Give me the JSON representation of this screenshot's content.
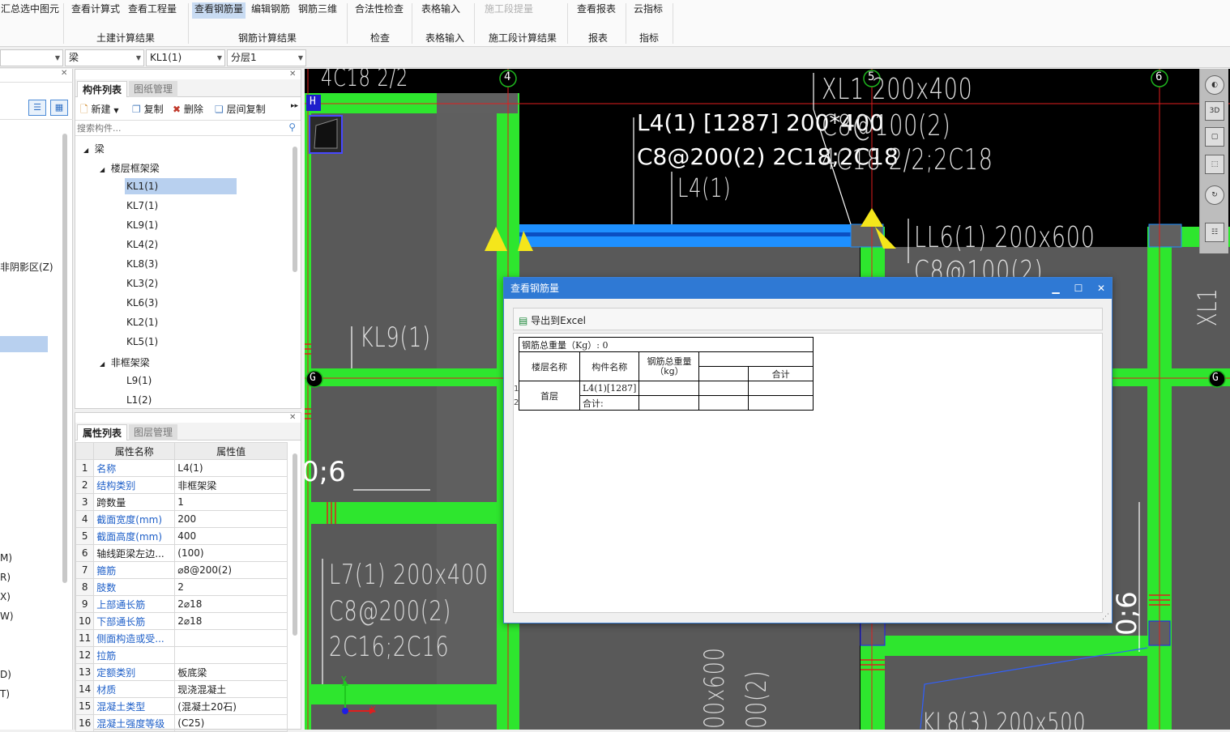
{
  "ribbon": {
    "buttons": [
      {
        "label": "汇总选中图元",
        "state": "normal"
      },
      {
        "label": "查看计算式",
        "state": "normal"
      },
      {
        "label": "查看工程量",
        "state": "normal"
      },
      {
        "label": "查看钢筋量",
        "state": "selected"
      },
      {
        "label": "编辑钢筋",
        "state": "normal"
      },
      {
        "label": "钢筋三维",
        "state": "normal"
      },
      {
        "label": "合法性检查",
        "state": "normal"
      },
      {
        "label": "表格输入",
        "state": "normal"
      },
      {
        "label": "施工段提量",
        "state": "disabled"
      },
      {
        "label": "查看报表",
        "state": "normal"
      },
      {
        "label": "云指标",
        "state": "normal"
      }
    ],
    "groups": [
      "土建计算结果",
      "钢筋计算结果",
      "检查",
      "表格输入",
      "施工段计算结果",
      "报表",
      "指标"
    ]
  },
  "selector_bar": {
    "combo1": "",
    "combo2": "梁",
    "combo3": "KL1(1)",
    "combo4": "分层1"
  },
  "left_panel": {
    "items": [
      "非阴影区(Z)",
      "M)",
      "R)",
      "X)",
      "W)",
      "D)",
      "T)"
    ]
  },
  "component_panel": {
    "tabs": [
      "构件列表",
      "图纸管理"
    ],
    "toolbar": {
      "new": "新建",
      "copy": "复制",
      "delete": "删除",
      "floor_copy": "层间复制"
    },
    "search_placeholder": "搜索构件...",
    "tree": {
      "root": "梁",
      "group1": "楼层框架梁",
      "group1_items": [
        "KL1(1)",
        "KL7(1)",
        "KL9(1)",
        "KL4(2)",
        "KL8(3)",
        "KL3(2)",
        "KL6(3)",
        "KL2(1)",
        "KL5(1)"
      ],
      "group2": "非框架梁",
      "group2_items": [
        "L9(1)",
        "L1(2)"
      ]
    }
  },
  "property_panel": {
    "tabs": [
      "属性列表",
      "图层管理"
    ],
    "headers": [
      "属性名称",
      "属性值"
    ],
    "rows": [
      {
        "n": "1",
        "k": "名称",
        "v": "L4(1)",
        "blue": true
      },
      {
        "n": "2",
        "k": "结构类别",
        "v": "非框架梁",
        "blue": true
      },
      {
        "n": "3",
        "k": "跨数量",
        "v": "1",
        "blue": false
      },
      {
        "n": "4",
        "k": "截面宽度(mm)",
        "v": "200",
        "blue": true
      },
      {
        "n": "5",
        "k": "截面高度(mm)",
        "v": "400",
        "blue": true
      },
      {
        "n": "6",
        "k": "轴线距梁左边...",
        "v": "(100)",
        "blue": false
      },
      {
        "n": "7",
        "k": "箍筋",
        "v": "⌀8@200(2)",
        "blue": true
      },
      {
        "n": "8",
        "k": "肢数",
        "v": "2",
        "blue": true
      },
      {
        "n": "9",
        "k": "上部通长筋",
        "v": "2⌀18",
        "blue": true
      },
      {
        "n": "10",
        "k": "下部通长筋",
        "v": "2⌀18",
        "blue": true
      },
      {
        "n": "11",
        "k": "侧面构造或受...",
        "v": "",
        "blue": true
      },
      {
        "n": "12",
        "k": "拉筋",
        "v": "",
        "blue": true
      },
      {
        "n": "13",
        "k": "定额类别",
        "v": "板底梁",
        "blue": true
      },
      {
        "n": "14",
        "k": "材质",
        "v": "现浇混凝土",
        "blue": true
      },
      {
        "n": "15",
        "k": "混凝土类型",
        "v": "(混凝土20石)",
        "blue": true
      },
      {
        "n": "16",
        "k": "混凝土强度等级",
        "v": "(C25)",
        "blue": true
      }
    ]
  },
  "cad": {
    "axis_labels": {
      "a4": "4",
      "a5": "5",
      "a6": "6",
      "aH": "H",
      "aG1": "G",
      "aG2": "G"
    },
    "texts": {
      "t1": "4C18 2/2",
      "t2": "L4(1) [1287] 200*400",
      "t3": "C8@200(2) 2C18;2C18",
      "t4": "L4(1)",
      "t5": "XL1 200x400",
      "t6": "C8@100(2)",
      "t7": "4C18 2/2;2C18",
      "t8": "LL6(1) 200x600",
      "t9": "C8@100(2)",
      "t10": "KL9(1)",
      "t11": "0;6",
      "t12": "L7(1) 200x400",
      "t13": "C8@200(2)",
      "t14": "2C16;2C16",
      "t15": "XL1",
      "t16": "0;6",
      "t17": "KL8(3) 200x500",
      "t18": "00x600",
      "t19": "00(2)"
    },
    "axis_x": "X",
    "axis_y": "Y"
  },
  "dialog": {
    "title": "查看钢筋量",
    "export_label": "导出到Excel",
    "total_label": "钢筋总重量（Kg）: 0",
    "headers": {
      "floor": "楼层名称",
      "component": "构件名称",
      "total_weight": "钢筋总重量（kg）",
      "sum": "合计"
    },
    "rows": [
      {
        "idx": "1",
        "floor": "首层",
        "component": "L4(1)[1287]"
      },
      {
        "idx": "2",
        "component": "合计:"
      }
    ]
  }
}
